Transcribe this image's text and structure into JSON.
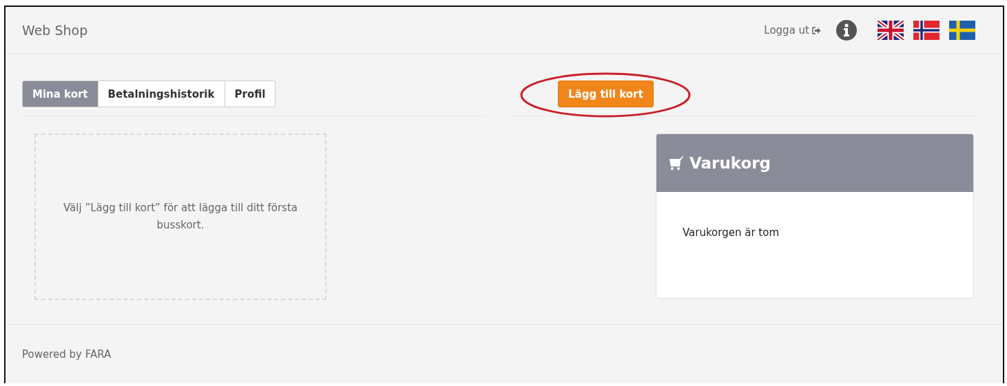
{
  "header": {
    "title": "Web Shop",
    "logout": "Logga ut",
    "languages": [
      {
        "kind": "uk",
        "selected": false
      },
      {
        "kind": "no",
        "selected": false
      },
      {
        "kind": "se",
        "selected": false
      }
    ]
  },
  "tabs": [
    {
      "label": "Mina kort",
      "selected": true
    },
    {
      "label": "Betalningshistorik",
      "selected": false
    },
    {
      "label": "Profil",
      "selected": false
    }
  ],
  "add_card_button": {
    "label": "Lägg till kort",
    "circled": true
  },
  "empty_cards_message": "Välj ”Lägg till kort” för att lägga till ditt första busskort.",
  "cart": {
    "title": "Varukorg",
    "empty_message": "Varukorgen är tom"
  },
  "footer": "Powered by FARA"
}
